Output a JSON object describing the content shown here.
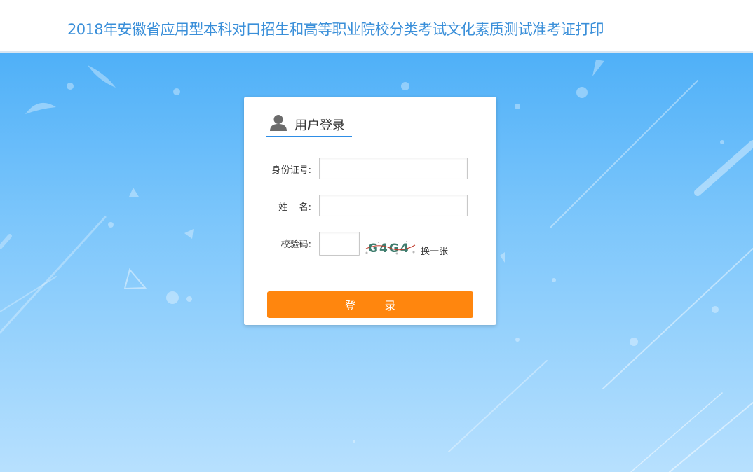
{
  "header": {
    "title": "2018年安徽省应用型本科对口招生和高等职业院校分类考试文化素质测试准考证打印"
  },
  "login_card": {
    "title": "用户登录",
    "user_icon": "user-icon",
    "id_label": "身份证号:",
    "id_value": "",
    "name_label": "姓    名:",
    "name_value": "",
    "code_label": "校验码:",
    "code_value": "",
    "captcha_text": "G4G4",
    "refresh_label": "换一张",
    "submit_label": "登 录"
  },
  "colors": {
    "header_title": "#3a8fd9",
    "accent_blue": "#2e8de6",
    "button_orange": "#ff860e",
    "bg_top": "#4fb0f8",
    "bg_bottom": "#b7e0fe"
  }
}
